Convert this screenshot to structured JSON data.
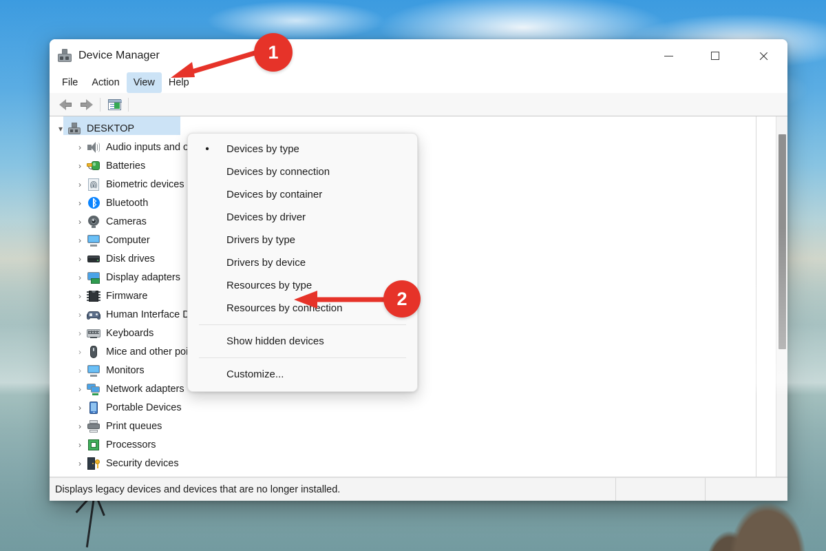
{
  "window": {
    "title": "Device Manager",
    "title_icon": "device-manager-icon",
    "controls": {
      "minimize": "minimize-icon",
      "maximize": "maximize-icon",
      "close": "close-icon"
    }
  },
  "menubar": {
    "items": [
      {
        "label": "File",
        "active": false
      },
      {
        "label": "Action",
        "active": false
      },
      {
        "label": "View",
        "active": true
      },
      {
        "label": "Help",
        "active": false
      }
    ]
  },
  "toolbar": {
    "buttons": [
      {
        "name": "back-icon"
      },
      {
        "name": "forward-icon"
      },
      {
        "name": "properties-icon"
      }
    ]
  },
  "view_menu": {
    "items": [
      {
        "label": "Devices by type",
        "checked": true
      },
      {
        "label": "Devices by connection",
        "checked": false
      },
      {
        "label": "Devices by container",
        "checked": false
      },
      {
        "label": "Devices by driver",
        "checked": false
      },
      {
        "label": "Drivers by type",
        "checked": false
      },
      {
        "label": "Drivers by device",
        "checked": false
      },
      {
        "label": "Resources by type",
        "checked": false
      },
      {
        "label": "Resources by connection",
        "checked": false
      }
    ],
    "show_hidden": {
      "label": "Show hidden devices"
    },
    "customize": {
      "label": "Customize..."
    }
  },
  "tree": {
    "root": {
      "label": "DESKTOP",
      "icon": "computer-icon",
      "expanded": true,
      "selected": true
    },
    "items": [
      {
        "label": "Audio inputs and outputs",
        "icon": "speaker-icon"
      },
      {
        "label": "Batteries",
        "icon": "battery-icon"
      },
      {
        "label": "Biometric devices",
        "icon": "fingerprint-icon"
      },
      {
        "label": "Bluetooth",
        "icon": "bluetooth-icon"
      },
      {
        "label": "Cameras",
        "icon": "camera-icon"
      },
      {
        "label": "Computer",
        "icon": "monitor-icon"
      },
      {
        "label": "Disk drives",
        "icon": "disk-icon"
      },
      {
        "label": "Display adapters",
        "icon": "display-adapter-icon"
      },
      {
        "label": "Firmware",
        "icon": "firmware-chip-icon"
      },
      {
        "label": "Human Interface Devices",
        "icon": "gamepad-icon"
      },
      {
        "label": "Keyboards",
        "icon": "keyboard-icon"
      },
      {
        "label": "Mice and other pointing devices",
        "icon": "mouse-icon"
      },
      {
        "label": "Monitors",
        "icon": "monitor-icon"
      },
      {
        "label": "Network adapters",
        "icon": "network-icon"
      },
      {
        "label": "Portable Devices",
        "icon": "portable-device-icon"
      },
      {
        "label": "Print queues",
        "icon": "printer-icon"
      },
      {
        "label": "Processors",
        "icon": "cpu-icon"
      },
      {
        "label": "Security devices",
        "icon": "security-icon"
      }
    ]
  },
  "statusbar": {
    "message": "Displays legacy devices and devices that are no longer installed."
  },
  "annotations": [
    {
      "number": "1",
      "target": "view-menu-button"
    },
    {
      "number": "2",
      "target": "show-hidden-devices-item"
    }
  ],
  "colors": {
    "accent_red": "#e63329",
    "menu_highlight": "#cce3f6",
    "window_bg": "#ffffff"
  }
}
